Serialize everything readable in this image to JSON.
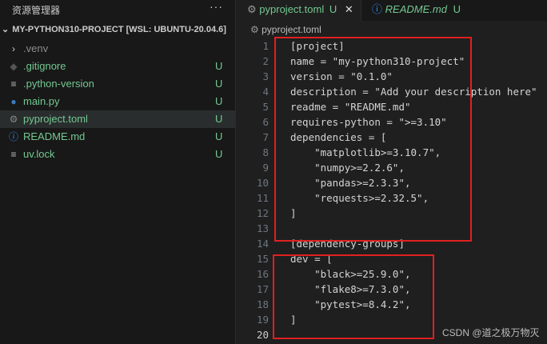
{
  "sidebar": {
    "title": "资源管理器",
    "more": "···",
    "project": "MY-PYTHON310-PROJECT [WSL: UBUNTU-20.04.6]",
    "items": [
      {
        "name": ".venv",
        "icon": "chevron-right-icon",
        "status": ""
      },
      {
        "name": ".gitignore",
        "icon": "git-icon",
        "status": "U"
      },
      {
        "name": ".python-version",
        "icon": "lines-icon",
        "status": "U"
      },
      {
        "name": "main.py",
        "icon": "python-icon",
        "status": "U"
      },
      {
        "name": "pyproject.toml",
        "icon": "gear-icon",
        "status": "U"
      },
      {
        "name": "README.md",
        "icon": "info-icon",
        "status": "U"
      },
      {
        "name": "uv.lock",
        "icon": "lines-icon",
        "status": "U"
      }
    ]
  },
  "tabs": [
    {
      "label": "pyproject.toml",
      "status": "U"
    },
    {
      "label": "README.md",
      "status": "U"
    }
  ],
  "breadcrumb": "pyproject.toml",
  "code": [
    "[project]",
    "name = \"my-python310-project\"",
    "version = \"0.1.0\"",
    "description = \"Add your description here\"",
    "readme = \"README.md\"",
    "requires-python = \">=3.10\"",
    "dependencies = [",
    "    \"matplotlib>=3.10.7\",",
    "    \"numpy>=2.2.6\",",
    "    \"pandas>=2.3.3\",",
    "    \"requests>=2.32.5\",",
    "]",
    "",
    "[dependency-groups]",
    "dev = [",
    "    \"black>=25.9.0\",",
    "    \"flake8>=7.3.0\",",
    "    \"pytest>=8.4.2\",",
    "]",
    ""
  ],
  "watermark": "CSDN @道之极万物灭"
}
